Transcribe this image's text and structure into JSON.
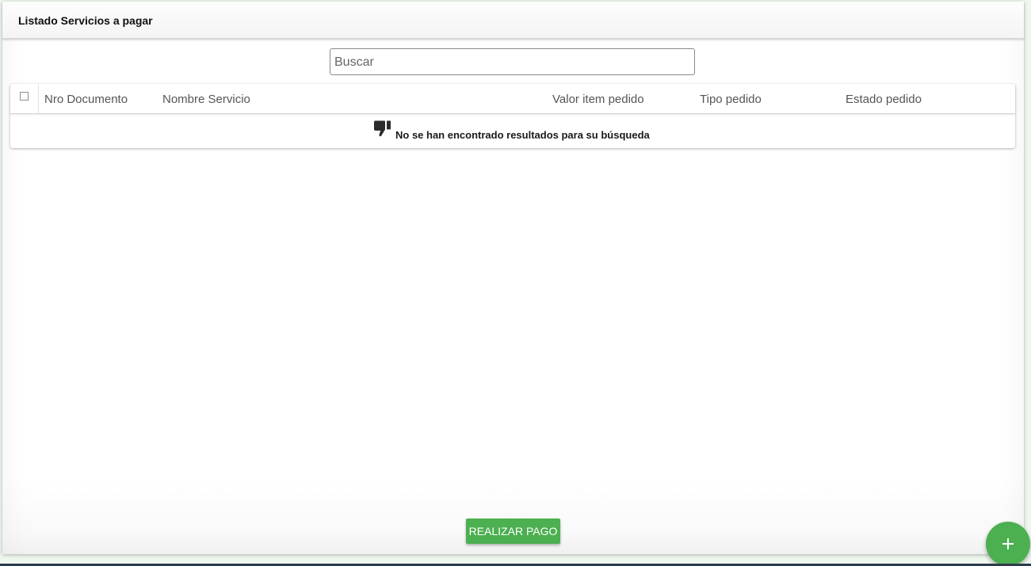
{
  "panel": {
    "title": "Listado Servicios a pagar"
  },
  "search": {
    "placeholder": "Buscar",
    "value": ""
  },
  "table": {
    "columns": [
      "Nro Documento",
      "Nombre Servicio",
      "Valor item pedido",
      "Tipo pedido",
      "Estado pedido"
    ],
    "rows": [],
    "empty_message": "No se han encontrado resultados para su búsqueda"
  },
  "actions": {
    "pay_label": "REALIZAR PAGO"
  },
  "icons": {
    "empty": "thumbs-down-icon",
    "fab": "plus-icon"
  },
  "colors": {
    "accent": "#4caf50"
  }
}
